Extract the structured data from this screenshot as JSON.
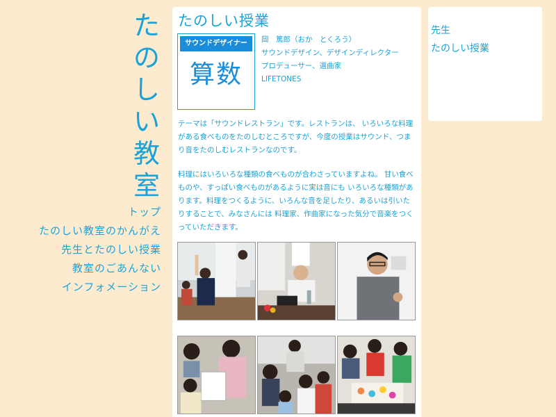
{
  "site": {
    "logo_chars": [
      "た",
      "の",
      "し",
      "い",
      "教",
      "室"
    ]
  },
  "nav": {
    "items": [
      {
        "label": "トップ"
      },
      {
        "label": "たのしい教室のかんがえ"
      },
      {
        "label": "先生とたのしい授業"
      },
      {
        "label": "教室のごあんない"
      },
      {
        "label": "インフォメーション"
      }
    ]
  },
  "main": {
    "title": "たのしい授業",
    "subject_card": {
      "role": "サウンドデザイナー",
      "subject": "算数"
    },
    "teacher": {
      "name": "岡　篤郎（おか　とくろう）",
      "title1": "サウンドデザイン、デザインディレクター",
      "title2": "プロデューサー、選曲家",
      "company": "LIFETONES"
    },
    "paragraph1": "テーマは「サウンドレストラン」です。レストランは、 いろいろな料理がある食べものをたのしむところですが、今度の授業はサウンド、つまり音をたのしむレストランなのです。",
    "paragraph2": "料理にはいろいろな種類の食べものが合わさっていますよね。 甘い食べものや、すっぱい食べものがあるように実は音にも いろいろな種類があります。料理をつくるように、いろんな音を足したり、あるいは引いたりすることで、みなさんには 料理家、作曲家になった気分で音楽をつくっていただきます。"
  },
  "sidebar_box": {
    "links": [
      {
        "label": "先生"
      },
      {
        "label": "たのしい授業"
      }
    ]
  },
  "colors": {
    "accent": "#1ba3d8",
    "page_bg": "#fdebd0",
    "badge_bg": "#1b8cd8"
  }
}
